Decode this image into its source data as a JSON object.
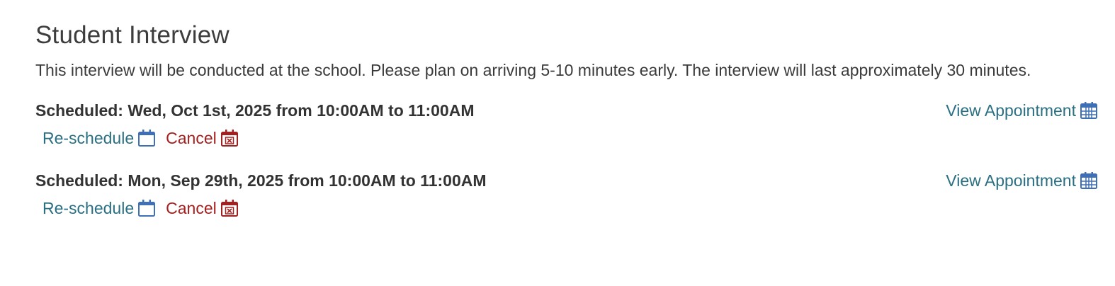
{
  "section": {
    "title": "Student Interview",
    "description": "This interview will be conducted at the school. Please plan on arriving 5-10 minutes early. The interview will last approximately 30 minutes."
  },
  "appointments": [
    {
      "scheduled_text": "Scheduled: Wed, Oct 1st, 2025 from 10:00AM to 11:00AM",
      "view_label": "View Appointment",
      "reschedule_label": "Re-schedule",
      "cancel_label": "Cancel"
    },
    {
      "scheduled_text": "Scheduled: Mon, Sep 29th, 2025 from 10:00AM to 11:00AM",
      "view_label": "View Appointment",
      "reschedule_label": "Re-schedule",
      "cancel_label": "Cancel"
    }
  ],
  "icons": {
    "view": "calendar-grid-icon",
    "reschedule": "calendar-icon",
    "cancel": "calendar-x-icon"
  },
  "colors": {
    "link": "#2a6f82",
    "icon_blue": "#3f6fb5",
    "cancel": "#a32020",
    "text": "#333333"
  }
}
